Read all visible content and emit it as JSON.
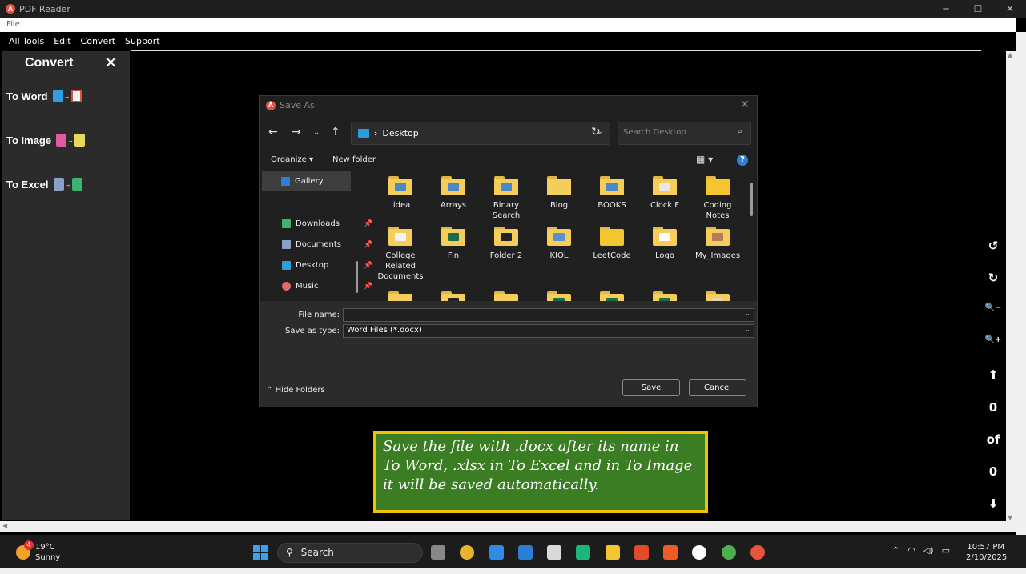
{
  "window": {
    "title": "PDF Reader",
    "controls": [
      "─",
      "☐",
      "✕"
    ]
  },
  "file_menu": "File",
  "menubar": [
    "All Tools",
    "Edit",
    "Convert",
    "Support"
  ],
  "sidebar": {
    "heading": "Convert",
    "close": "✕",
    "tools": [
      {
        "label": "To Word"
      },
      {
        "label": "To Image"
      },
      {
        "label": "To Excel"
      }
    ]
  },
  "rightbar": {
    "rotate_ccw": "↺",
    "rotate_cw": "↻",
    "zoom_out": "🔍−",
    "zoom_in": "🔍+",
    "up": "⬆",
    "page": "0",
    "of": "of",
    "total": "0",
    "down": "⬇"
  },
  "dialog": {
    "title": "Save As",
    "path": "Desktop",
    "search_placeholder": "Search Desktop",
    "organize": "Organize ▾",
    "new_folder": "New folder",
    "nav": [
      {
        "label": "Gallery",
        "color": "#2f7fd7"
      },
      {
        "label": "Downloads",
        "color": "#3cb371"
      },
      {
        "label": "Documents",
        "color": "#8aa0c8"
      },
      {
        "label": "Desktop",
        "color": "#2e9de0"
      },
      {
        "label": "Music",
        "color": "#e06a6a"
      }
    ],
    "files": [
      ".idea",
      "Arrays",
      "Binary Search",
      "Blog",
      "BOOKS",
      "Clock F",
      "Coding Notes",
      "College Related Documents",
      "Fin",
      "Folder 2",
      "KIOL",
      "LeetCode",
      "Logo",
      "My_Images"
    ],
    "file_name_label": "File name:",
    "file_name_value": "",
    "save_type_label": "Save as type:",
    "save_type_value": "Word Files (*.docx)",
    "save": "Save",
    "cancel": "Cancel",
    "hide_folders": "Hide Folders"
  },
  "note": "Save the file with .docx after its name in To Word, .xlsx in To Excel and in To Image it will be saved automatically.",
  "taskbar": {
    "temp": "19°C",
    "condition": "Sunny",
    "badge": "4",
    "search": "Search",
    "time": "10:57 PM",
    "date": "2/10/2025"
  }
}
